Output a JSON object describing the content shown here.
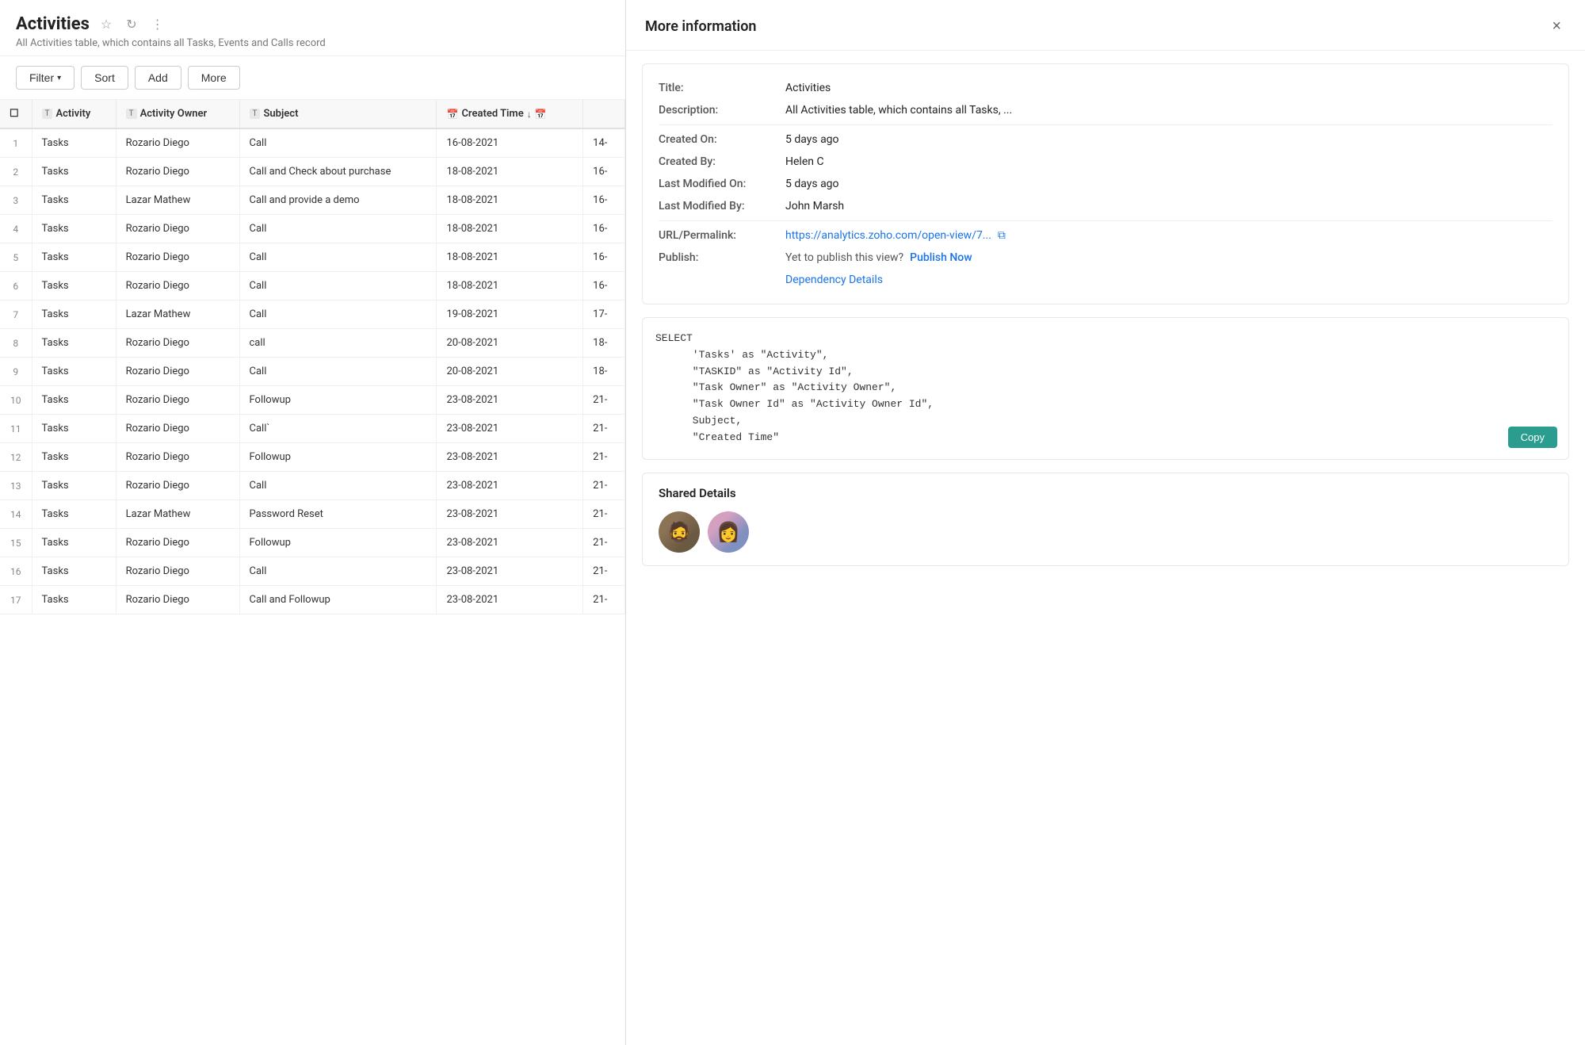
{
  "page": {
    "title": "Activities",
    "subtitle": "All Activities table, which contains all Tasks, Events and Calls record"
  },
  "toolbar": {
    "filter_label": "Filter",
    "sort_label": "Sort",
    "add_label": "Add",
    "more_label": "More"
  },
  "table": {
    "columns": [
      {
        "id": "rownum",
        "label": "#",
        "type": null
      },
      {
        "id": "activity",
        "label": "Activity",
        "type": "T"
      },
      {
        "id": "owner",
        "label": "Activity Owner",
        "type": "T"
      },
      {
        "id": "subject",
        "label": "Subject",
        "type": "T"
      },
      {
        "id": "created_time",
        "label": "Created Time",
        "type": "date"
      },
      {
        "id": "extra",
        "label": "",
        "type": null
      }
    ],
    "rows": [
      {
        "num": 1,
        "activity": "Tasks",
        "owner": "Rozario Diego",
        "subject": "Call",
        "created_time": "16-08-2021",
        "extra": "14-"
      },
      {
        "num": 2,
        "activity": "Tasks",
        "owner": "Rozario Diego",
        "subject": "Call and Check about purchase",
        "created_time": "18-08-2021",
        "extra": "16-"
      },
      {
        "num": 3,
        "activity": "Tasks",
        "owner": "Lazar Mathew",
        "subject": "Call and provide a demo",
        "created_time": "18-08-2021",
        "extra": "16-"
      },
      {
        "num": 4,
        "activity": "Tasks",
        "owner": "Rozario Diego",
        "subject": "Call",
        "created_time": "18-08-2021",
        "extra": "16-"
      },
      {
        "num": 5,
        "activity": "Tasks",
        "owner": "Rozario Diego",
        "subject": "Call",
        "created_time": "18-08-2021",
        "extra": "16-"
      },
      {
        "num": 6,
        "activity": "Tasks",
        "owner": "Rozario Diego",
        "subject": "Call",
        "created_time": "18-08-2021",
        "extra": "16-"
      },
      {
        "num": 7,
        "activity": "Tasks",
        "owner": "Lazar Mathew",
        "subject": "Call",
        "created_time": "19-08-2021",
        "extra": "17-"
      },
      {
        "num": 8,
        "activity": "Tasks",
        "owner": "Rozario Diego",
        "subject": "call",
        "created_time": "20-08-2021",
        "extra": "18-"
      },
      {
        "num": 9,
        "activity": "Tasks",
        "owner": "Rozario Diego",
        "subject": "Call",
        "created_time": "20-08-2021",
        "extra": "18-"
      },
      {
        "num": 10,
        "activity": "Tasks",
        "owner": "Rozario Diego",
        "subject": "Followup",
        "created_time": "23-08-2021",
        "extra": "21-"
      },
      {
        "num": 11,
        "activity": "Tasks",
        "owner": "Rozario Diego",
        "subject": "Call`",
        "created_time": "23-08-2021",
        "extra": "21-"
      },
      {
        "num": 12,
        "activity": "Tasks",
        "owner": "Rozario Diego",
        "subject": "Followup",
        "created_time": "23-08-2021",
        "extra": "21-"
      },
      {
        "num": 13,
        "activity": "Tasks",
        "owner": "Rozario Diego",
        "subject": "Call",
        "created_time": "23-08-2021",
        "extra": "21-"
      },
      {
        "num": 14,
        "activity": "Tasks",
        "owner": "Lazar Mathew",
        "subject": "Password Reset",
        "created_time": "23-08-2021",
        "extra": "21-"
      },
      {
        "num": 15,
        "activity": "Tasks",
        "owner": "Rozario Diego",
        "subject": "Followup",
        "created_time": "23-08-2021",
        "extra": "21-"
      },
      {
        "num": 16,
        "activity": "Tasks",
        "owner": "Rozario Diego",
        "subject": "Call",
        "created_time": "23-08-2021",
        "extra": "21-"
      },
      {
        "num": 17,
        "activity": "Tasks",
        "owner": "Rozario Diego",
        "subject": "Call and Followup",
        "created_time": "23-08-2021",
        "extra": "21-"
      }
    ]
  },
  "side_panel": {
    "title": "More information",
    "close_label": "×",
    "info": {
      "title_label": "Title:",
      "title_value": "Activities",
      "description_label": "Description:",
      "description_value": "All Activities table, which contains all Tasks, ...",
      "created_on_label": "Created On:",
      "created_on_value": "5 days ago",
      "created_by_label": "Created By:",
      "created_by_value": "Helen C",
      "last_modified_on_label": "Last Modified On:",
      "last_modified_on_value": "5 days ago",
      "last_modified_by_label": "Last Modified By:",
      "last_modified_by_value": "John Marsh",
      "url_label": "URL/Permalink:",
      "url_value": "https://analytics.zoho.com/open-view/7...",
      "publish_label": "Publish:",
      "publish_yet_text": "Yet to publish this view?",
      "publish_now_label": "Publish Now",
      "dependency_label": "Dependency Details"
    },
    "sql": {
      "content": "SELECT\n      'Tasks' as \"Activity\",\n      \"TASKID\" as \"Activity Id\",\n      \"Task Owner\" as \"Activity Owner\",\n      \"Task Owner Id\" as \"Activity Owner Id\",\n      Subject,\n      \"Created Time\""
    },
    "copy_label": "Copy",
    "shared": {
      "title": "Shared Details",
      "avatars": [
        "👨‍🦳",
        "👩"
      ]
    }
  }
}
